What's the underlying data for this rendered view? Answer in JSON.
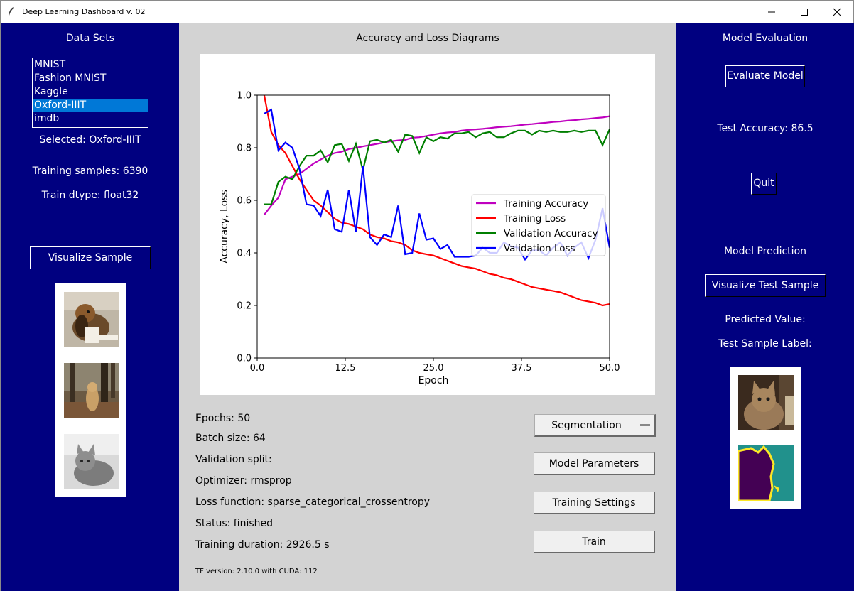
{
  "window": {
    "title": "Deep Learning Dashboard v. 02"
  },
  "left": {
    "heading": "Data Sets",
    "datasets": [
      "MNIST",
      "Fashion MNIST",
      "Kaggle",
      "Oxford-IIIT",
      "imdb"
    ],
    "selected_index": 3,
    "selected_label": "Selected: Oxford-IIIT",
    "training_samples": "Training samples: 6390",
    "train_dtype": "Train dtype: float32",
    "visualize_button": "Visualize Sample",
    "sample_images": [
      "dog-photo",
      "dog-in-forest-photo",
      "grey-cat-photo"
    ]
  },
  "center": {
    "heading": "Accuracy and Loss Diagrams",
    "info": {
      "epochs": "Epochs: 50",
      "batch_size": "Batch size: 64",
      "validation_split": "Validation split:",
      "optimizer": "Optimizer: rmsprop",
      "loss_function": "Loss function: sparse_categorical_crossentropy",
      "status": "Status: finished",
      "training_duration": "Training duration: 2926.5 s",
      "tf_version": "TF version: 2.10.0 with CUDA: 112"
    },
    "buttons": {
      "segmentation": "Segmentation",
      "model_parameters": "Model Parameters",
      "training_settings": "Training Settings",
      "train": "Train"
    }
  },
  "right": {
    "heading": "Model Evaluation",
    "evaluate_button": "Evaluate Model",
    "test_accuracy": "Test Accuracy: 86.5",
    "quit_button": "Quit",
    "prediction_heading": "Model Prediction",
    "visualize_test_button": "Visualize Test Sample",
    "predicted_value": "Predicted Value:",
    "test_sample_label": "Test Sample Label:",
    "images": [
      "cat-photo",
      "segmentation-mask"
    ]
  },
  "chart_data": {
    "type": "line",
    "title": "",
    "xlabel": "Epoch",
    "ylabel": "Accuracy, Loss",
    "xlim": [
      0,
      50
    ],
    "ylim": [
      0,
      1.0
    ],
    "xticks": [
      "0.0",
      "12.5",
      "25.0",
      "37.5",
      "50.0"
    ],
    "yticks": [
      "0.0",
      "0.2",
      "0.4",
      "0.6",
      "0.8",
      "1.0"
    ],
    "legend_position": "center-right",
    "x": [
      1,
      2,
      3,
      4,
      5,
      6,
      7,
      8,
      9,
      10,
      11,
      12,
      13,
      14,
      15,
      16,
      17,
      18,
      19,
      20,
      21,
      22,
      23,
      24,
      25,
      26,
      27,
      28,
      29,
      30,
      31,
      32,
      33,
      34,
      35,
      36,
      37,
      38,
      39,
      40,
      41,
      42,
      43,
      44,
      45,
      46,
      47,
      48,
      49,
      50
    ],
    "series": [
      {
        "name": "Training Accuracy",
        "color": "#bf00bf",
        "values": [
          0.545,
          0.58,
          0.61,
          0.68,
          0.69,
          0.7,
          0.72,
          0.74,
          0.755,
          0.77,
          0.78,
          0.785,
          0.795,
          0.8,
          0.805,
          0.81,
          0.815,
          0.82,
          0.825,
          0.828,
          0.83,
          0.838,
          0.84,
          0.845,
          0.85,
          0.855,
          0.858,
          0.86,
          0.865,
          0.868,
          0.87,
          0.872,
          0.875,
          0.878,
          0.88,
          0.882,
          0.885,
          0.888,
          0.89,
          0.893,
          0.895,
          0.898,
          0.9,
          0.903,
          0.905,
          0.908,
          0.91,
          0.913,
          0.915,
          0.92
        ]
      },
      {
        "name": "Training Loss",
        "color": "#ff0000",
        "values": [
          1.0,
          0.86,
          0.81,
          0.78,
          0.73,
          0.68,
          0.64,
          0.6,
          0.58,
          0.555,
          0.53,
          0.515,
          0.51,
          0.5,
          0.49,
          0.47,
          0.46,
          0.455,
          0.445,
          0.44,
          0.43,
          0.41,
          0.4,
          0.395,
          0.39,
          0.38,
          0.37,
          0.36,
          0.35,
          0.345,
          0.34,
          0.33,
          0.32,
          0.315,
          0.305,
          0.3,
          0.29,
          0.28,
          0.27,
          0.265,
          0.26,
          0.255,
          0.25,
          0.24,
          0.23,
          0.22,
          0.215,
          0.21,
          0.2,
          0.205
        ]
      },
      {
        "name": "Validation Accuracy",
        "color": "#007f00",
        "values": [
          0.585,
          0.585,
          0.67,
          0.69,
          0.68,
          0.73,
          0.77,
          0.77,
          0.79,
          0.745,
          0.81,
          0.815,
          0.75,
          0.815,
          0.715,
          0.825,
          0.83,
          0.82,
          0.83,
          0.785,
          0.85,
          0.845,
          0.78,
          0.84,
          0.825,
          0.84,
          0.835,
          0.855,
          0.855,
          0.86,
          0.84,
          0.855,
          0.86,
          0.84,
          0.84,
          0.855,
          0.865,
          0.865,
          0.85,
          0.865,
          0.86,
          0.865,
          0.86,
          0.86,
          0.865,
          0.86,
          0.865,
          0.865,
          0.81,
          0.87
        ]
      },
      {
        "name": "Validation Loss",
        "color": "#0000ff",
        "values": [
          0.93,
          0.945,
          0.79,
          0.82,
          0.8,
          0.72,
          0.585,
          0.58,
          0.54,
          0.64,
          0.49,
          0.48,
          0.64,
          0.48,
          0.73,
          0.46,
          0.43,
          0.47,
          0.46,
          0.58,
          0.395,
          0.4,
          0.55,
          0.45,
          0.455,
          0.415,
          0.43,
          0.385,
          0.385,
          0.385,
          0.39,
          0.42,
          0.4,
          0.4,
          0.44,
          0.425,
          0.42,
          0.375,
          0.41,
          0.41,
          0.39,
          0.42,
          0.44,
          0.39,
          0.42,
          0.44,
          0.38,
          0.45,
          0.57,
          0.42
        ]
      }
    ]
  }
}
